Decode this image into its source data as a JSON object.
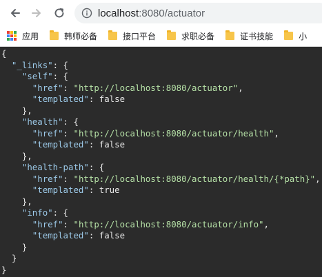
{
  "browser": {
    "url_host": "localhost",
    "url_rest": ":8080/actuator",
    "bookmarks": [
      {
        "label": "应用",
        "icon": "apps-icon"
      },
      {
        "label": "韩师必备",
        "icon": "folder-icon"
      },
      {
        "label": "接口平台",
        "icon": "folder-icon"
      },
      {
        "label": "求职必备",
        "icon": "folder-icon"
      },
      {
        "label": "证书技能",
        "icon": "folder-icon"
      },
      {
        "label": "小",
        "icon": "folder-icon"
      }
    ]
  },
  "json": {
    "root_key": "_links",
    "links": [
      {
        "name": "self",
        "href": "http://localhost:8080/actuator",
        "templated": "false"
      },
      {
        "name": "health",
        "href": "http://localhost:8080/actuator/health",
        "templated": "false"
      },
      {
        "name": "health-path",
        "href": "http://localhost:8080/actuator/health/{*path}",
        "templated": "true"
      },
      {
        "name": "info",
        "href": "http://localhost:8080/actuator/info",
        "templated": "false"
      }
    ],
    "href_key": "href",
    "templated_key": "templated"
  },
  "colors": {
    "background": "#2b2b2b",
    "key": "#9cc9e8",
    "string": "#b5e0a6",
    "punct": "#e8e8e8"
  }
}
